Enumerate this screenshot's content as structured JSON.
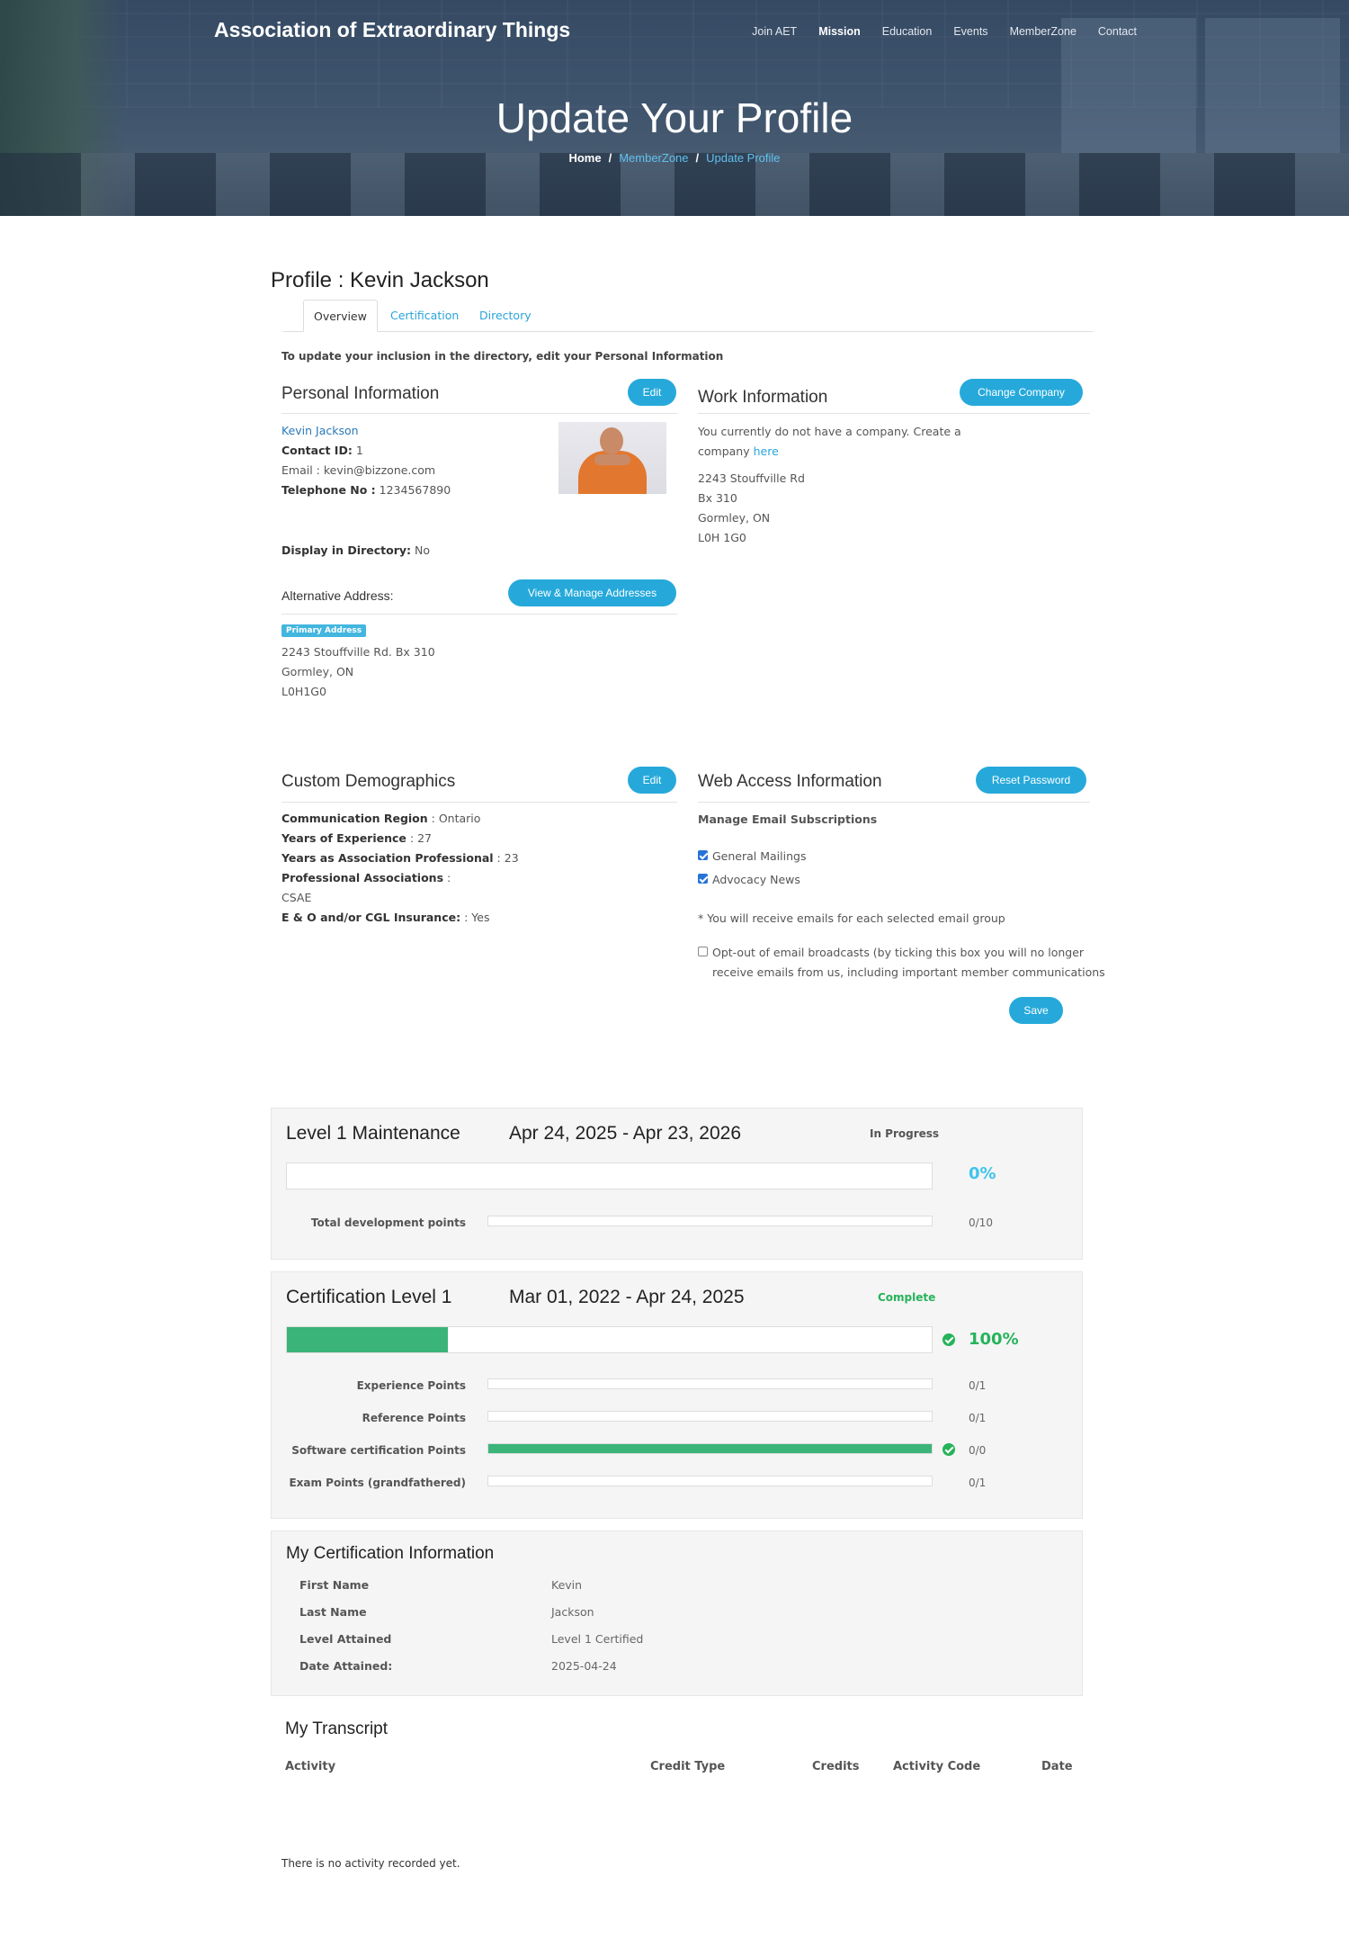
{
  "header": {
    "brand": "Association of Extraordinary Things",
    "nav": [
      "Join AET",
      "Mission",
      "Education",
      "Events",
      "MemberZone",
      "Contact"
    ],
    "hero_title": "Update Your Profile",
    "breadcrumb": [
      "Home",
      "MemberZone",
      "Update Profile"
    ]
  },
  "profile": {
    "title": "Profile : Kevin Jackson",
    "tabs": [
      "Overview",
      "Certification",
      "Directory"
    ],
    "intro": "To update your inclusion in the directory, edit your Personal Information"
  },
  "personal": {
    "title": "Personal Information",
    "edit_label": "Edit",
    "name": "Kevin Jackson",
    "contact_id_label": "Contact ID:",
    "contact_id": "1",
    "email_label": "Email :",
    "email": "kevin@bizzone.com",
    "telephone_label": "Telephone No :",
    "telephone": "1234567890",
    "display_label": "Display in Directory:",
    "display_value": "No",
    "alt_address_title": "Alternative Address:",
    "manage_label": "View & Manage Addresses",
    "primary_badge": "Primary Address",
    "address_lines": [
      "2243 Stouffville Rd. Bx 310",
      "Gormley, ON",
      "L0H1G0"
    ]
  },
  "work": {
    "title": "Work Information",
    "change_label": "Change Company",
    "no_company_1": "You currently do not have a company. Create a",
    "no_company_2": "company",
    "here": "here",
    "address_lines": [
      "2243 Stouffville Rd",
      "Bx 310",
      "Gormley, ON",
      "L0H 1G0"
    ]
  },
  "demographics": {
    "title": "Custom Demographics",
    "edit_label": "Edit",
    "items": [
      {
        "label": "Communication Region",
        "sep": " : ",
        "value": "Ontario"
      },
      {
        "label": "Years of Experience",
        "sep": " : ",
        "value": "27"
      },
      {
        "label": "Years as Association Professional",
        "sep": " : ",
        "value": "23"
      },
      {
        "label": "Professional Associations",
        "sep": " :",
        "value": ""
      },
      {
        "label": "",
        "sep": "",
        "value": "CSAE"
      },
      {
        "label": "E & O and/or CGL Insurance:",
        "sep": " : ",
        "value": "Yes"
      }
    ]
  },
  "web_access": {
    "title": "Web Access Information",
    "reset_label": "Reset Password",
    "subs_title": "Manage Email Subscriptions",
    "subscriptions": [
      "General Mailings",
      "Advocacy News"
    ],
    "note": "* You will receive emails for each selected email group",
    "optout_1": "Opt-out of email broadcasts (by ticking this box you will no longer",
    "optout_2": "receive emails from us, including important member communications",
    "save_label": "Save"
  },
  "level1_maintenance": {
    "title": "Level 1 Maintenance",
    "dates": "Apr 24, 2025 - Apr 23, 2026",
    "status": "In Progress",
    "progress": 0,
    "progress_text": "0%",
    "rows": [
      {
        "label": "Total development points",
        "value": "0/10",
        "fill": 0
      }
    ]
  },
  "certification_level1": {
    "title": "Certification Level 1",
    "dates": "Mar 01, 2022 - Apr 24, 2025",
    "status": "Complete",
    "progress": 0.25,
    "progress_text": "100%",
    "rows": [
      {
        "label": "Experience Points",
        "value": "0/1",
        "fill": 0
      },
      {
        "label": "Reference Points",
        "value": "0/1",
        "fill": 0
      },
      {
        "label": "Software certification Points",
        "value": "0/0",
        "fill": 1
      },
      {
        "label": "Exam Points (grandfathered)",
        "value": "0/1",
        "fill": 0
      }
    ]
  },
  "cert_info": {
    "title": "My Certification Information",
    "rows": [
      {
        "label": "First Name",
        "value": "Kevin"
      },
      {
        "label": "Last Name",
        "value": "Jackson"
      },
      {
        "label": "Level Attained",
        "value": "Level 1 Certified"
      },
      {
        "label": "Date Attained:",
        "value": "2025-04-24"
      }
    ]
  },
  "transcript": {
    "title": "My Transcript",
    "columns": [
      "Activity",
      "Credit Type",
      "Credits",
      "Activity Code",
      "Date"
    ],
    "empty": "There is no activity recorded yet."
  },
  "colors": {
    "accent": "#26a9da",
    "success": "#26b35a",
    "bar_fill": "#3bb47a"
  }
}
